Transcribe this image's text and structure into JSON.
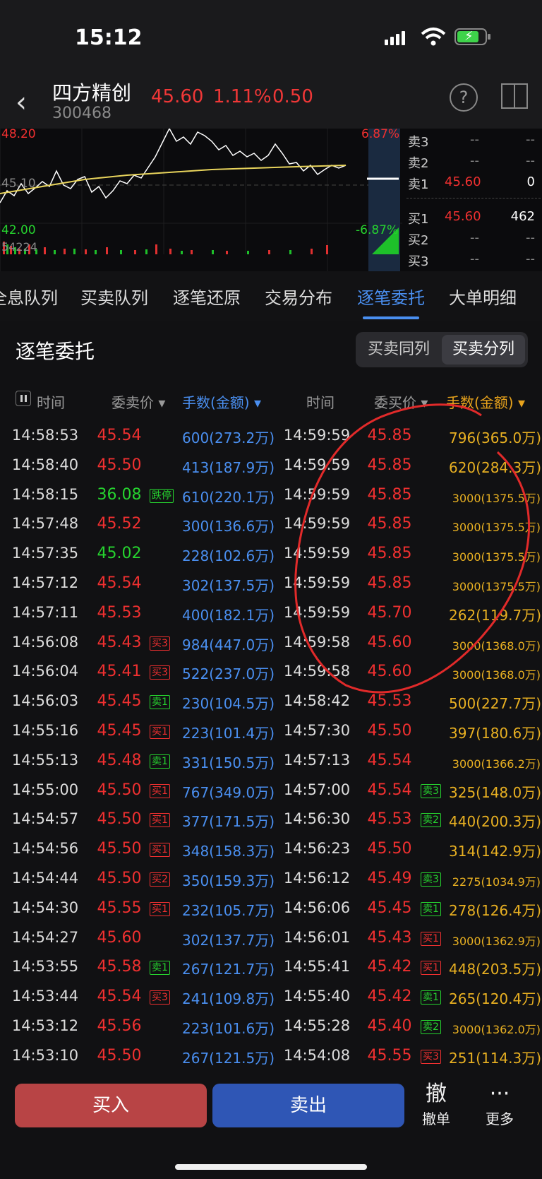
{
  "status_bar": {
    "time": "15:12"
  },
  "header": {
    "name": "四方精创",
    "code": "300468",
    "price": "45.60",
    "change_pct": "1.11%",
    "change": "0.50"
  },
  "chart": {
    "high_label": "48.20",
    "mid_label": "45.10",
    "low_label": "42.00",
    "high_pct": "6.87%",
    "low_pct": "-6.87%",
    "volume_label": "54224"
  },
  "order_book": {
    "sell": [
      {
        "label": "卖3",
        "price": "--",
        "vol": "--"
      },
      {
        "label": "卖2",
        "price": "--",
        "vol": "--"
      },
      {
        "label": "卖1",
        "price": "45.60",
        "vol": "0"
      }
    ],
    "buy": [
      {
        "label": "买1",
        "price": "45.60",
        "vol": "462"
      },
      {
        "label": "买2",
        "price": "--",
        "vol": "--"
      },
      {
        "label": "买3",
        "price": "--",
        "vol": "--"
      }
    ]
  },
  "tabs": [
    "全息队列",
    "买卖队列",
    "逐笔还原",
    "交易分布",
    "逐笔委托",
    "大单明细"
  ],
  "active_tab": "逐笔委托",
  "section": {
    "title": "逐笔委托",
    "segment": [
      "买卖同列",
      "买卖分列"
    ],
    "active_segment": "买卖分列"
  },
  "columns": {
    "time": "时间",
    "sell_price": "委卖价",
    "sell_amount": "手数(金额)",
    "time2": "时间",
    "buy_price": "委买价",
    "buy_amount": "手数(金额)"
  },
  "rows": [
    {
      "lt": "14:58:53",
      "lp": "45.54",
      "lc": "red",
      "lb": "",
      "la": "600(273.2万)",
      "rt": "14:59:59",
      "rp": "45.85",
      "rc": "red",
      "rb": "",
      "ra": "796(365.0万)"
    },
    {
      "lt": "14:58:40",
      "lp": "45.50",
      "lc": "red",
      "lb": "",
      "la": "413(187.9万)",
      "rt": "14:59:59",
      "rp": "45.85",
      "rc": "red",
      "rb": "",
      "ra": "620(284.3万)"
    },
    {
      "lt": "14:58:15",
      "lp": "36.08",
      "lc": "green",
      "lb": "跌停",
      "la": "610(220.1万)",
      "rt": "14:59:59",
      "rp": "45.85",
      "rc": "red",
      "rb": "",
      "ra": "3000(1375.5万)"
    },
    {
      "lt": "14:57:48",
      "lp": "45.52",
      "lc": "red",
      "lb": "",
      "la": "300(136.6万)",
      "rt": "14:59:59",
      "rp": "45.85",
      "rc": "red",
      "rb": "",
      "ra": "3000(1375.5万)"
    },
    {
      "lt": "14:57:35",
      "lp": "45.02",
      "lc": "green",
      "lb": "",
      "la": "228(102.6万)",
      "rt": "14:59:59",
      "rp": "45.85",
      "rc": "red",
      "rb": "",
      "ra": "3000(1375.5万)"
    },
    {
      "lt": "14:57:12",
      "lp": "45.54",
      "lc": "red",
      "lb": "",
      "la": "302(137.5万)",
      "rt": "14:59:59",
      "rp": "45.85",
      "rc": "red",
      "rb": "",
      "ra": "3000(1375.5万)"
    },
    {
      "lt": "14:57:11",
      "lp": "45.53",
      "lc": "red",
      "lb": "",
      "la": "400(182.1万)",
      "rt": "14:59:59",
      "rp": "45.70",
      "rc": "red",
      "rb": "",
      "ra": "262(119.7万)"
    },
    {
      "lt": "14:56:08",
      "lp": "45.43",
      "lc": "red",
      "lb": "买3",
      "la": "984(447.0万)",
      "rt": "14:59:58",
      "rp": "45.60",
      "rc": "red",
      "rb": "",
      "ra": "3000(1368.0万)"
    },
    {
      "lt": "14:56:04",
      "lp": "45.41",
      "lc": "red",
      "lb": "买3",
      "la": "522(237.0万)",
      "rt": "14:59:58",
      "rp": "45.60",
      "rc": "red",
      "rb": "",
      "ra": "3000(1368.0万)"
    },
    {
      "lt": "14:56:03",
      "lp": "45.45",
      "lc": "red",
      "lb": "卖1",
      "la": "230(104.5万)",
      "rt": "14:58:42",
      "rp": "45.53",
      "rc": "red",
      "rb": "",
      "ra": "500(227.7万)"
    },
    {
      "lt": "14:55:16",
      "lp": "45.45",
      "lc": "red",
      "lb": "买1",
      "la": "223(101.4万)",
      "rt": "14:57:30",
      "rp": "45.50",
      "rc": "red",
      "rb": "",
      "ra": "397(180.6万)"
    },
    {
      "lt": "14:55:13",
      "lp": "45.48",
      "lc": "red",
      "lb": "卖1",
      "la": "331(150.5万)",
      "rt": "14:57:13",
      "rp": "45.54",
      "rc": "red",
      "rb": "",
      "ra": "3000(1366.2万)"
    },
    {
      "lt": "14:55:00",
      "lp": "45.50",
      "lc": "red",
      "lb": "买1",
      "la": "767(349.0万)",
      "rt": "14:57:00",
      "rp": "45.54",
      "rc": "red",
      "rb": "卖3",
      "ra": "325(148.0万)"
    },
    {
      "lt": "14:54:57",
      "lp": "45.50",
      "lc": "red",
      "lb": "买1",
      "la": "377(171.5万)",
      "rt": "14:56:30",
      "rp": "45.53",
      "rc": "red",
      "rb": "卖2",
      "ra": "440(200.3万)"
    },
    {
      "lt": "14:54:56",
      "lp": "45.50",
      "lc": "red",
      "lb": "买1",
      "la": "348(158.3万)",
      "rt": "14:56:23",
      "rp": "45.50",
      "rc": "red",
      "rb": "",
      "ra": "314(142.9万)"
    },
    {
      "lt": "14:54:44",
      "lp": "45.50",
      "lc": "red",
      "lb": "买2",
      "la": "350(159.3万)",
      "rt": "14:56:12",
      "rp": "45.49",
      "rc": "red",
      "rb": "卖3",
      "ra": "2275(1034.9万)"
    },
    {
      "lt": "14:54:30",
      "lp": "45.55",
      "lc": "red",
      "lb": "买1",
      "la": "232(105.7万)",
      "rt": "14:56:06",
      "rp": "45.45",
      "rc": "red",
      "rb": "卖1",
      "ra": "278(126.4万)"
    },
    {
      "lt": "14:54:27",
      "lp": "45.60",
      "lc": "red",
      "lb": "",
      "la": "302(137.7万)",
      "rt": "14:56:01",
      "rp": "45.43",
      "rc": "red",
      "rb": "买1",
      "ra": "3000(1362.9万)"
    },
    {
      "lt": "14:53:55",
      "lp": "45.58",
      "lc": "red",
      "lb": "卖1",
      "la": "267(121.7万)",
      "rt": "14:55:41",
      "rp": "45.42",
      "rc": "red",
      "rb": "买1",
      "ra": "448(203.5万)"
    },
    {
      "lt": "14:53:44",
      "lp": "45.54",
      "lc": "red",
      "lb": "买3",
      "la": "241(109.8万)",
      "rt": "14:55:40",
      "rp": "45.42",
      "rc": "red",
      "rb": "卖1",
      "ra": "265(120.4万)"
    },
    {
      "lt": "14:53:12",
      "lp": "45.56",
      "lc": "red",
      "lb": "",
      "la": "223(101.6万)",
      "rt": "14:55:28",
      "rp": "45.40",
      "rc": "red",
      "rb": "卖2",
      "ra": "3000(1362.0万)"
    },
    {
      "lt": "14:53:10",
      "lp": "45.50",
      "lc": "red",
      "lb": "",
      "la": "267(121.5万)",
      "rt": "14:54:08",
      "rp": "45.55",
      "rc": "red",
      "rb": "买3",
      "ra": "251(114.3万)"
    }
  ],
  "bottom": {
    "buy": "买入",
    "sell": "卖出",
    "cancel_icon": "撤",
    "cancel": "撤单",
    "more_icon": "···",
    "more": "更多"
  },
  "colors": {
    "up": "#f03030",
    "down": "#26d32f",
    "accent": "#4a8ff0",
    "gold": "#e8b022"
  }
}
